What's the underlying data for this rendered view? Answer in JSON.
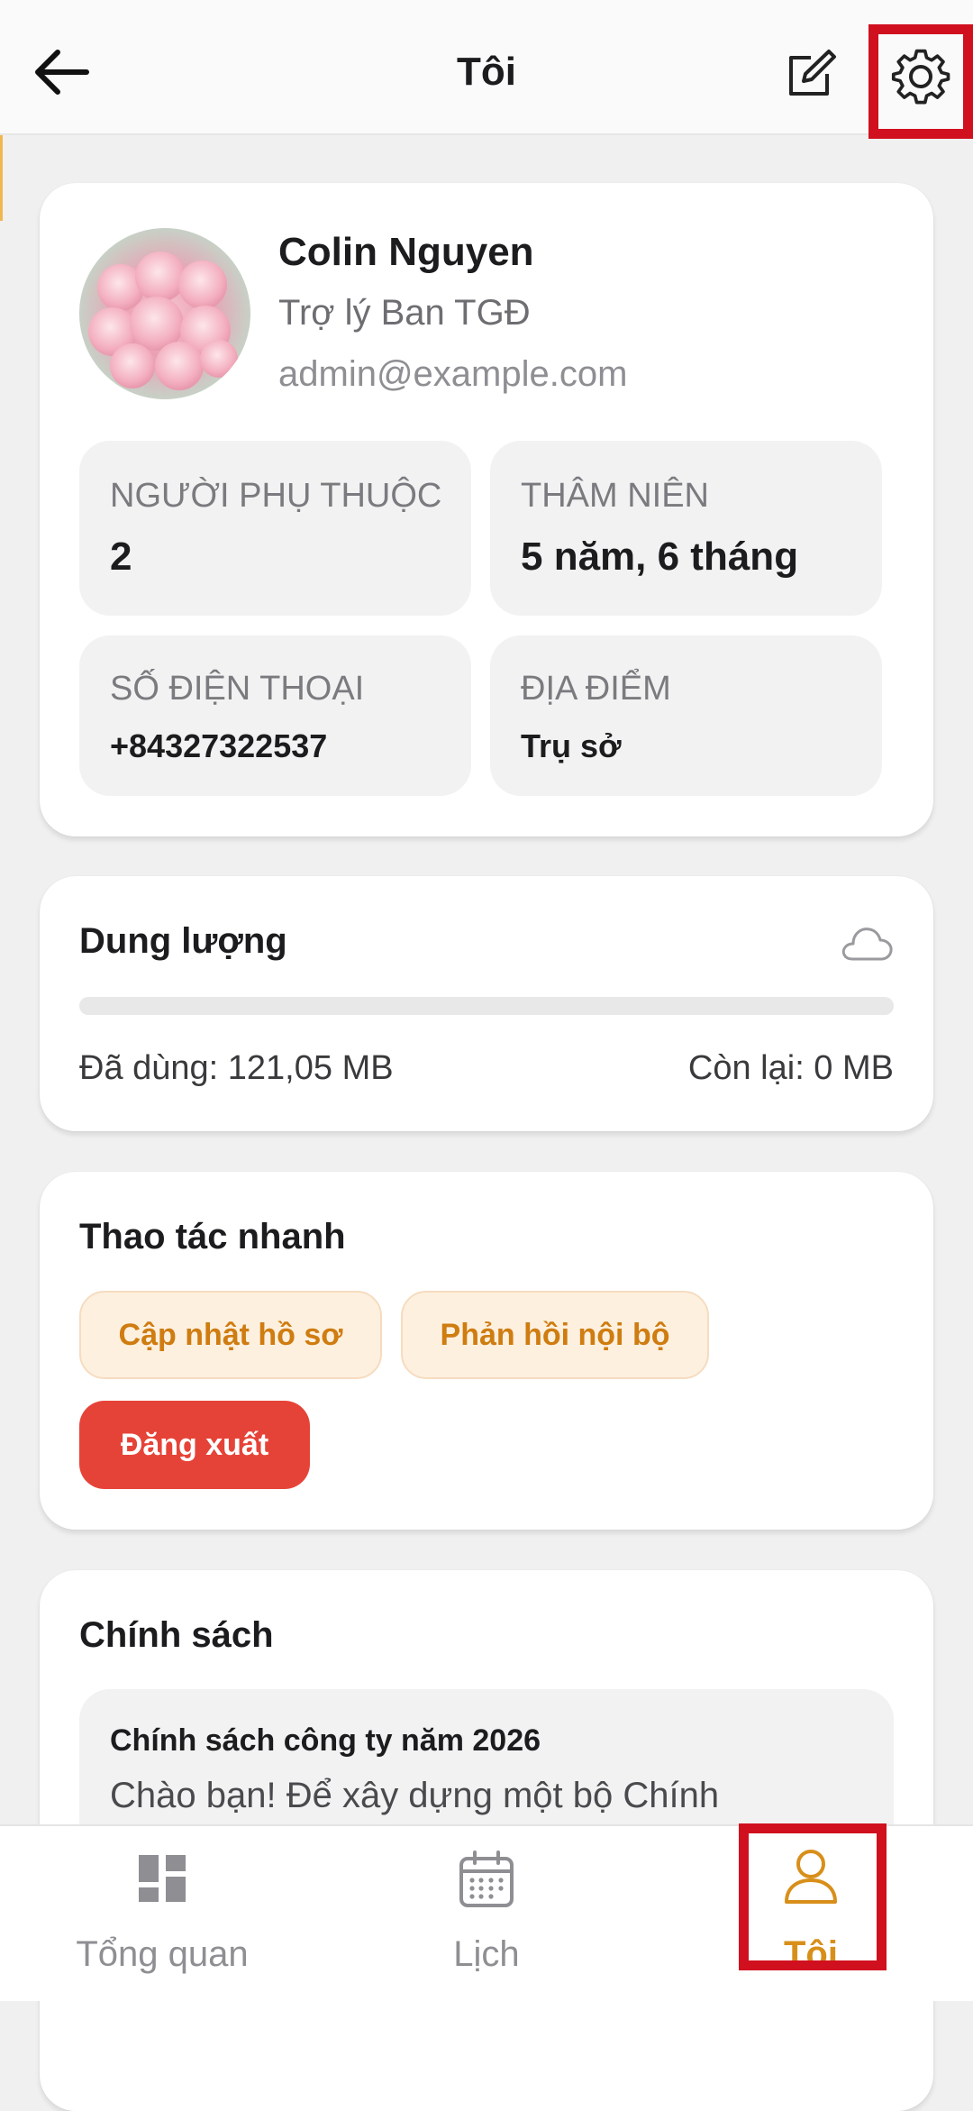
{
  "header": {
    "title": "Tôi",
    "back_icon": "arrow-left-icon",
    "edit_icon": "edit-icon",
    "settings_icon": "gear-icon"
  },
  "profile": {
    "name": "Colin Nguyen",
    "role": "Trợ lý Ban TGĐ",
    "email": "admin@example.com",
    "stats": [
      {
        "label": "NGƯỜI PHỤ THUỘC",
        "value": "2"
      },
      {
        "label": "THÂM NIÊN",
        "value": "5 năm, 6 tháng"
      },
      {
        "label": "SỐ ĐIỆN THOẠI",
        "value": "+84327322537"
      },
      {
        "label": "ĐỊA ĐIỂM",
        "value": "Trụ sở"
      }
    ]
  },
  "storage": {
    "title": "Dung lượng",
    "icon": "cloud-icon",
    "used_label": "Đã dùng: 121,05 MB",
    "remaining_label": "Còn lại: 0 MB",
    "progress_fraction": 0
  },
  "quick_actions": {
    "title": "Thao tác nhanh",
    "update_profile": "Cập nhật hồ sơ",
    "internal_feedback": "Phản hồi nội bộ",
    "logout": "Đăng xuất"
  },
  "policy": {
    "title": "Chính sách",
    "item_title": "Chính sách công ty năm 2026",
    "item_preview": "Chào bạn! Để xây dựng một bộ Chính"
  },
  "tabbar": {
    "tabs": [
      {
        "label": "Tổng quan",
        "icon": "dashboard-icon"
      },
      {
        "label": "Lịch",
        "icon": "calendar-icon"
      },
      {
        "label": "Tôi",
        "icon": "user-icon"
      }
    ]
  },
  "colors": {
    "accent": "#d88f1a",
    "danger": "#e64338",
    "highlight": "#d0101f"
  }
}
